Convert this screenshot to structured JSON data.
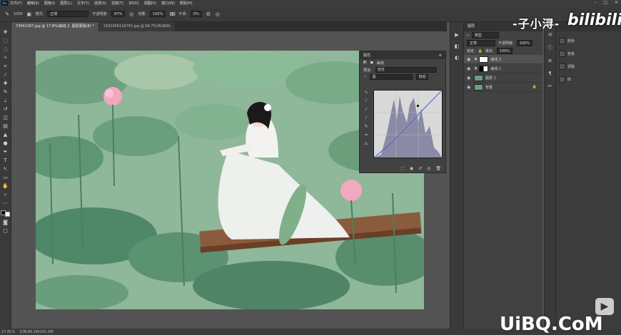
{
  "menubar": {
    "logo": "Ps",
    "items": [
      "文件(F)",
      "编辑(E)",
      "图像(I)",
      "图层(L)",
      "文字(Y)",
      "选择(S)",
      "滤镜(T)",
      "3D(D)",
      "视图(V)",
      "窗口(W)",
      "帮助(H)"
    ]
  },
  "options": {
    "size": "1000",
    "mode_label": "模式:",
    "mode_value": "正常",
    "opacity_label": "不透明度:",
    "opacity_value": "87%",
    "flow_label": "流量:",
    "flow_value": "100%",
    "smooth_label": "平滑:",
    "smooth_value": "0%"
  },
  "tabs": [
    {
      "label": "73041367.jpg @ 17.8%(曲线 2, 图层蒙版/8) *"
    },
    {
      "label": "1591456118755.jpg @ 66.7%(RGB/8)"
    }
  ],
  "properties": {
    "tab": "属性",
    "title": "曲线",
    "preset_label": "预设:",
    "preset_value": "自定",
    "channel_value": "蓝",
    "auto_label": "自动"
  },
  "layers": {
    "tab": "图层",
    "kind": "类型",
    "blend": "正常",
    "opacity_label": "不透明度:",
    "opacity_value": "100%",
    "lock_label": "锁定:",
    "fill_label": "填充:",
    "fill_value": "100%",
    "items": [
      {
        "name": "曲线 2",
        "selected": true
      },
      {
        "name": "曲线 1",
        "selected": false
      },
      {
        "name": "图层 1",
        "selected": false
      },
      {
        "name": "背景",
        "selected": false
      }
    ]
  },
  "panel3": {
    "items": [
      "颜色",
      "色板",
      "调整",
      "库"
    ]
  },
  "status": {
    "zoom": "17.81%",
    "doc": "文档:86.1M/201.0M"
  },
  "watermarks": {
    "name": "-子小浔-",
    "site": "bilibili",
    "footer": "UiBQ.CoM",
    "tv_icon": "tv-icon"
  },
  "colors": {
    "accent": "#1473e6",
    "curve_line": "#4a6cd4",
    "histogram": "#8a8aa6"
  }
}
